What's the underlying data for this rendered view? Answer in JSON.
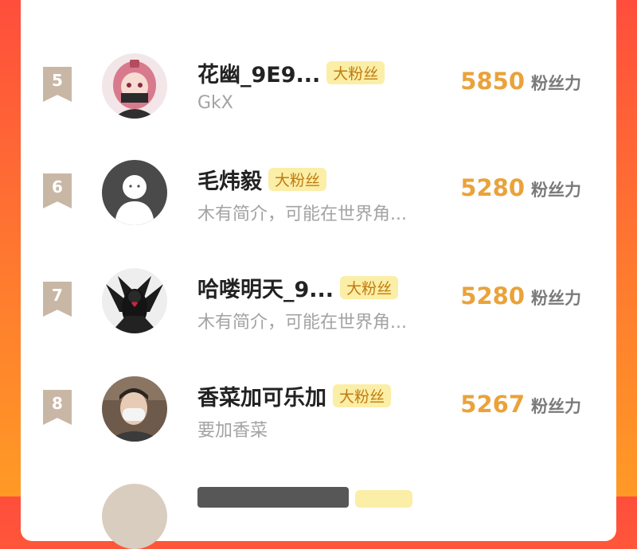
{
  "colors": {
    "background_top": "#ff4e3c",
    "background_bottom": "#ff9a25",
    "score": "#eaa23a",
    "badge_bg": "#fbeea6",
    "badge_text": "#c07a10",
    "rank_bg": "#c9b7a6"
  },
  "rows": [
    {
      "rank": "5",
      "name": "花幽_9E9...",
      "badge": "大粉丝",
      "bio": "GkX",
      "score": "5850",
      "score_unit": "粉丝力",
      "avatar_icon": "anime-girl-avatar"
    },
    {
      "rank": "6",
      "name": "毛炜毅",
      "badge": "大粉丝",
      "bio": "木有简介，可能在世界角...",
      "score": "5280",
      "score_unit": "粉丝力",
      "avatar_icon": "default-user-avatar"
    },
    {
      "rank": "7",
      "name": "哈喽明天_9...",
      "badge": "大粉丝",
      "bio": "木有简介，可能在世界角...",
      "score": "5280",
      "score_unit": "粉丝力",
      "avatar_icon": "dark-figure-avatar"
    },
    {
      "rank": "8",
      "name": "香菜加可乐加",
      "badge": "大粉丝",
      "bio": "要加香菜",
      "score": "5267",
      "score_unit": "粉丝力",
      "avatar_icon": "masked-person-avatar"
    }
  ]
}
